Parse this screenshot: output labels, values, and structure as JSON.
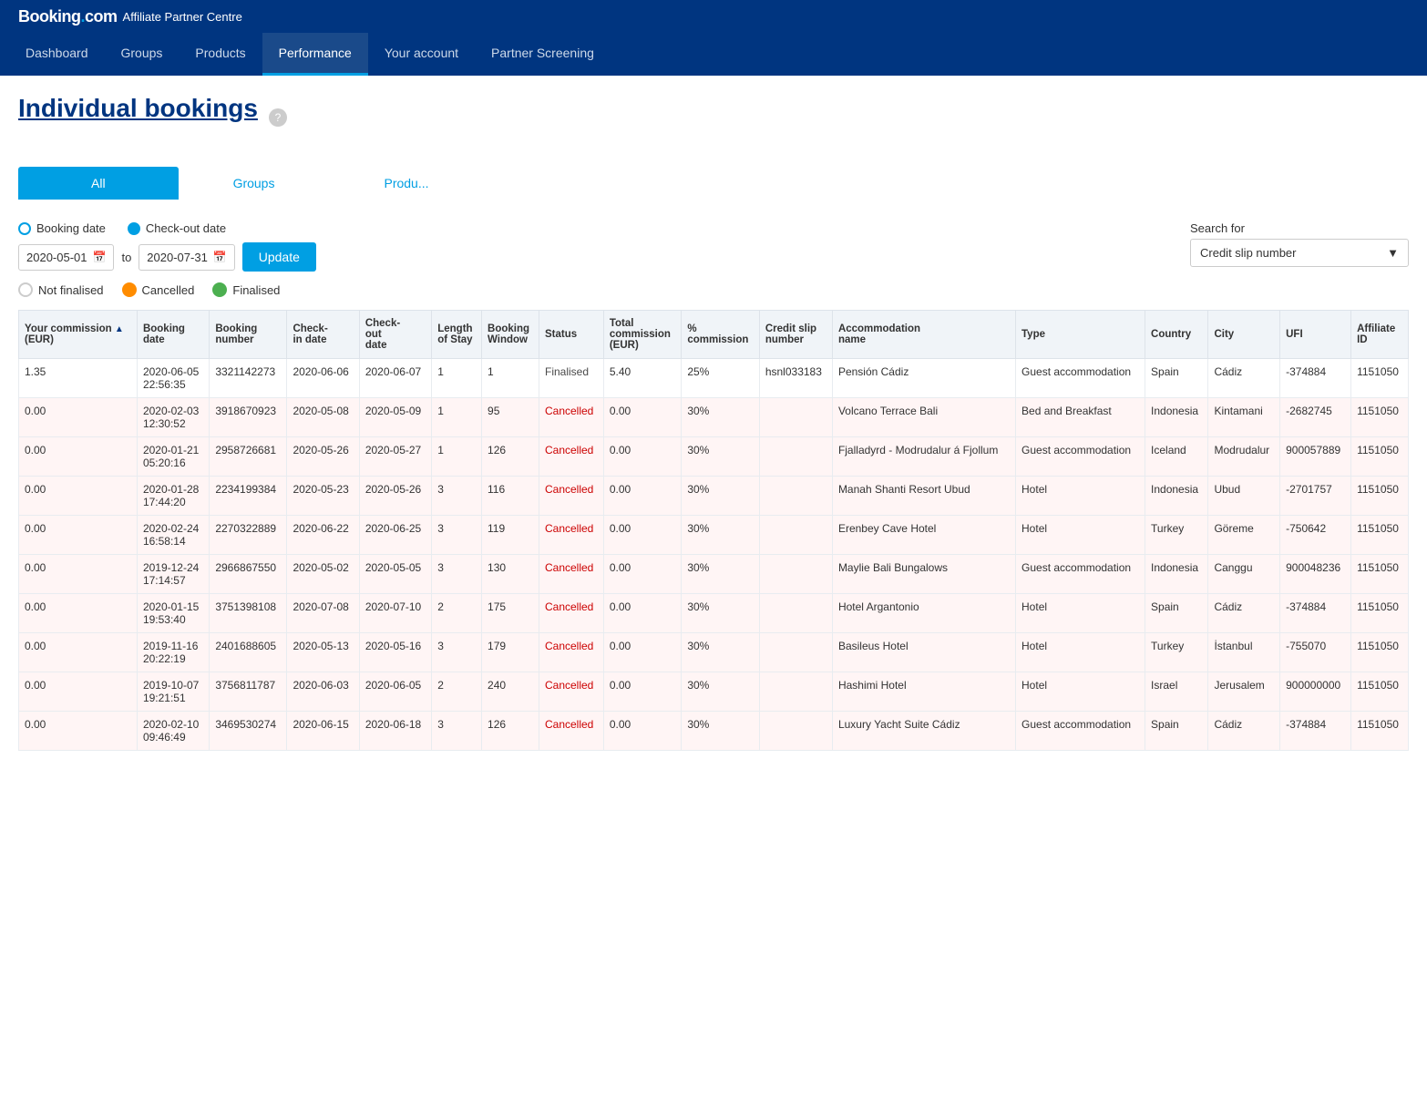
{
  "brand": {
    "logo": "Booking",
    "logo_dot": ".",
    "com": "com",
    "subtitle": "Affiliate Partner Centre"
  },
  "nav": {
    "items": [
      {
        "label": "Dashboard",
        "active": false
      },
      {
        "label": "Groups",
        "active": false
      },
      {
        "label": "Products",
        "active": false
      },
      {
        "label": "Performance",
        "active": true
      },
      {
        "label": "Your account",
        "active": false
      },
      {
        "label": "Partner Screening",
        "active": false
      }
    ]
  },
  "page": {
    "title": "Individual bookings",
    "help_icon": "?"
  },
  "tabs": [
    {
      "label": "All",
      "active": true
    },
    {
      "label": "Groups",
      "active": false
    },
    {
      "label": "Produ...",
      "active": false
    }
  ],
  "filters": {
    "booking_date_label": "Booking date",
    "checkout_date_label": "Check-out date",
    "date_from": "2020-05-01",
    "date_to": "2020-07-31",
    "to_label": "to",
    "update_button": "Update",
    "not_finalised_label": "Not finalised",
    "cancelled_label": "Cancelled",
    "finalised_label": "Finalised",
    "search_for_label": "Search for",
    "search_placeholder": "Credit slip number"
  },
  "table": {
    "columns": [
      "Your commission (EUR)",
      "Booking date",
      "Booking number",
      "Check-in date",
      "Check-out date",
      "Length of Stay",
      "Booking Window",
      "Status",
      "Total commission (EUR)",
      "% commission",
      "Credit slip number",
      "Accommodation name",
      "Type",
      "Country",
      "City",
      "UFI",
      "Affiliate ID"
    ],
    "rows": [
      {
        "commission": "1.35",
        "booking_date": "2020-06-05 22:56:35",
        "booking_number": "3321142273",
        "checkin": "2020-06-06",
        "checkout": "2020-06-07",
        "length_stay": "1",
        "booking_window": "1",
        "status": "Finalised",
        "total_commission": "5.40",
        "pct_commission": "25%",
        "credit_slip": "hsnl033183",
        "accommodation": "Pensión Cádiz",
        "type": "Guest accommodation",
        "country": "Spain",
        "city": "Cádiz",
        "ufi": "-374884",
        "affiliate_id": "1151050",
        "row_class": "finalised"
      },
      {
        "commission": "0.00",
        "booking_date": "2020-02-03 12:30:52",
        "booking_number": "3918670923",
        "checkin": "2020-05-08",
        "checkout": "2020-05-09",
        "length_stay": "1",
        "booking_window": "95",
        "status": "Cancelled",
        "total_commission": "0.00",
        "pct_commission": "30%",
        "credit_slip": "",
        "accommodation": "Volcano Terrace Bali",
        "type": "Bed and Breakfast",
        "country": "Indonesia",
        "city": "Kintamani",
        "ufi": "-2682745",
        "affiliate_id": "1151050",
        "row_class": "cancelled"
      },
      {
        "commission": "0.00",
        "booking_date": "2020-01-21 05:20:16",
        "booking_number": "2958726681",
        "checkin": "2020-05-26",
        "checkout": "2020-05-27",
        "length_stay": "1",
        "booking_window": "126",
        "status": "Cancelled",
        "total_commission": "0.00",
        "pct_commission": "30%",
        "credit_slip": "",
        "accommodation": "Fjalladyrd - Modrudalur á Fjollum",
        "type": "Guest accommodation",
        "country": "Iceland",
        "city": "Modrudalur",
        "ufi": "900057889",
        "affiliate_id": "1151050",
        "row_class": "cancelled"
      },
      {
        "commission": "0.00",
        "booking_date": "2020-01-28 17:44:20",
        "booking_number": "2234199384",
        "checkin": "2020-05-23",
        "checkout": "2020-05-26",
        "length_stay": "3",
        "booking_window": "116",
        "status": "Cancelled",
        "total_commission": "0.00",
        "pct_commission": "30%",
        "credit_slip": "",
        "accommodation": "Manah Shanti Resort Ubud",
        "type": "Hotel",
        "country": "Indonesia",
        "city": "Ubud",
        "ufi": "-2701757",
        "affiliate_id": "1151050",
        "row_class": "cancelled"
      },
      {
        "commission": "0.00",
        "booking_date": "2020-02-24 16:58:14",
        "booking_number": "2270322889",
        "checkin": "2020-06-22",
        "checkout": "2020-06-25",
        "length_stay": "3",
        "booking_window": "119",
        "status": "Cancelled",
        "total_commission": "0.00",
        "pct_commission": "30%",
        "credit_slip": "",
        "accommodation": "Erenbey Cave Hotel",
        "type": "Hotel",
        "country": "Turkey",
        "city": "Göreme",
        "ufi": "-750642",
        "affiliate_id": "1151050",
        "row_class": "cancelled"
      },
      {
        "commission": "0.00",
        "booking_date": "2019-12-24 17:14:57",
        "booking_number": "2966867550",
        "checkin": "2020-05-02",
        "checkout": "2020-05-05",
        "length_stay": "3",
        "booking_window": "130",
        "status": "Cancelled",
        "total_commission": "0.00",
        "pct_commission": "30%",
        "credit_slip": "",
        "accommodation": "Maylie Bali Bungalows",
        "type": "Guest accommodation",
        "country": "Indonesia",
        "city": "Canggu",
        "ufi": "900048236",
        "affiliate_id": "1151050",
        "row_class": "cancelled"
      },
      {
        "commission": "0.00",
        "booking_date": "2020-01-15 19:53:40",
        "booking_number": "3751398108",
        "checkin": "2020-07-08",
        "checkout": "2020-07-10",
        "length_stay": "2",
        "booking_window": "175",
        "status": "Cancelled",
        "total_commission": "0.00",
        "pct_commission": "30%",
        "credit_slip": "",
        "accommodation": "Hotel Argantonio",
        "type": "Hotel",
        "country": "Spain",
        "city": "Cádiz",
        "ufi": "-374884",
        "affiliate_id": "1151050",
        "row_class": "cancelled"
      },
      {
        "commission": "0.00",
        "booking_date": "2019-11-16 20:22:19",
        "booking_number": "2401688605",
        "checkin": "2020-05-13",
        "checkout": "2020-05-16",
        "length_stay": "3",
        "booking_window": "179",
        "status": "Cancelled",
        "total_commission": "0.00",
        "pct_commission": "30%",
        "credit_slip": "",
        "accommodation": "Basileus Hotel",
        "type": "Hotel",
        "country": "Turkey",
        "city": "İstanbul",
        "ufi": "-755070",
        "affiliate_id": "1151050",
        "row_class": "cancelled"
      },
      {
        "commission": "0.00",
        "booking_date": "2019-10-07 19:21:51",
        "booking_number": "3756811787",
        "checkin": "2020-06-03",
        "checkout": "2020-06-05",
        "length_stay": "2",
        "booking_window": "240",
        "status": "Cancelled",
        "total_commission": "0.00",
        "pct_commission": "30%",
        "credit_slip": "",
        "accommodation": "Hashimi Hotel",
        "type": "Hotel",
        "country": "Israel",
        "city": "Jerusalem",
        "ufi": "900000000",
        "affiliate_id": "1151050",
        "row_class": "cancelled"
      },
      {
        "commission": "0.00",
        "booking_date": "2020-02-10 09:46:49",
        "booking_number": "3469530274",
        "checkin": "2020-06-15",
        "checkout": "2020-06-18",
        "length_stay": "3",
        "booking_window": "126",
        "status": "Cancelled",
        "total_commission": "0.00",
        "pct_commission": "30%",
        "credit_slip": "",
        "accommodation": "Luxury Yacht Suite Cádiz",
        "type": "Guest accommodation",
        "country": "Spain",
        "city": "Cádiz",
        "ufi": "-374884",
        "affiliate_id": "1151050",
        "row_class": "cancelled"
      }
    ]
  }
}
